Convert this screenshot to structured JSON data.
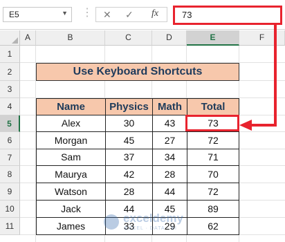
{
  "formula_bar": {
    "name_box": "E5",
    "cancel_icon": "✕",
    "enter_icon": "✓",
    "fx_label": "fx",
    "formula_value": "73"
  },
  "columns": [
    "A",
    "B",
    "C",
    "D",
    "E",
    "F"
  ],
  "rows": [
    "1",
    "2",
    "3",
    "4",
    "5",
    "6",
    "7",
    "8",
    "9",
    "10",
    "11"
  ],
  "title": "Use Keyboard Shortcuts",
  "table": {
    "headers": [
      "Name",
      "Physics",
      "Math",
      "Total"
    ],
    "rows": [
      [
        "Alex",
        "30",
        "43",
        "73"
      ],
      [
        "Morgan",
        "45",
        "27",
        "72"
      ],
      [
        "Sam",
        "37",
        "34",
        "71"
      ],
      [
        "Maurya",
        "42",
        "28",
        "70"
      ],
      [
        "Watson",
        "28",
        "44",
        "72"
      ],
      [
        "Jack",
        "44",
        "45",
        "89"
      ],
      [
        "James",
        "33",
        "29",
        "62"
      ]
    ]
  },
  "watermark": {
    "name": "exceldemy",
    "tagline": "EXCEL · DATA · BI"
  },
  "colors": {
    "header_fill": "#f7c8ac",
    "highlight_red": "#e8232e",
    "excel_green": "#217346"
  }
}
